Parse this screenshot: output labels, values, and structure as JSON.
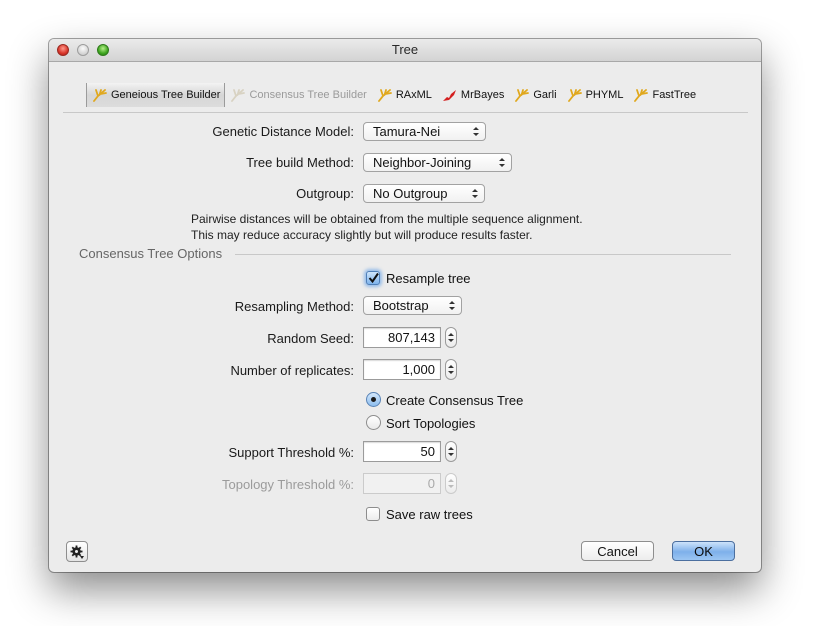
{
  "window": {
    "title": "Tree"
  },
  "tabs": [
    {
      "label": "Geneious Tree Builder",
      "icon": "tree-icon",
      "selected": true,
      "enabled": true,
      "icon_color": "#e0a81e"
    },
    {
      "label": "Consensus Tree Builder",
      "icon": "tree-icon",
      "selected": false,
      "enabled": false,
      "icon_color": "#d8d2c2"
    },
    {
      "label": "RAxML",
      "icon": "tree-icon",
      "selected": false,
      "enabled": true,
      "icon_color": "#e0a81e"
    },
    {
      "label": "MrBayes",
      "icon": "mrbayes-icon",
      "selected": false,
      "enabled": true,
      "icon_color": "#d42020"
    },
    {
      "label": "Garli",
      "icon": "tree-icon",
      "selected": false,
      "enabled": true,
      "icon_color": "#e0a81e"
    },
    {
      "label": "PHYML",
      "icon": "tree-icon",
      "selected": false,
      "enabled": true,
      "icon_color": "#e0a81e"
    },
    {
      "label": "FastTree",
      "icon": "tree-icon",
      "selected": false,
      "enabled": true,
      "icon_color": "#e0a81e"
    }
  ],
  "main": {
    "distance_model": {
      "label": "Genetic Distance Model:",
      "value": "Tamura-Nei"
    },
    "build_method": {
      "label": "Tree build Method:",
      "value": "Neighbor-Joining"
    },
    "outgroup": {
      "label": "Outgroup:",
      "value": "No Outgroup"
    },
    "description": [
      "Pairwise distances will be obtained from the multiple sequence alignment.",
      "This may reduce accuracy slightly but will produce results faster."
    ]
  },
  "consensus": {
    "group_title": "Consensus Tree Options",
    "resample_tree": {
      "label": "Resample tree",
      "checked": true
    },
    "resampling_method": {
      "label": "Resampling Method:",
      "value": "Bootstrap"
    },
    "random_seed": {
      "label": "Random Seed:",
      "value": "807,143"
    },
    "replicates": {
      "label": "Number of replicates:",
      "value": "1,000"
    },
    "mode_options": [
      {
        "label": "Create Consensus Tree",
        "selected": true
      },
      {
        "label": "Sort Topologies",
        "selected": false
      }
    ],
    "support_threshold": {
      "label": "Support Threshold %:",
      "value": "50",
      "enabled": true
    },
    "topology_threshold": {
      "label": "Topology Threshold %:",
      "value": "0",
      "enabled": false
    },
    "save_raw_trees": {
      "label": "Save raw trees",
      "checked": false
    }
  },
  "footer": {
    "options_icon": "gear-icon",
    "cancel_label": "Cancel",
    "ok_label": "OK"
  }
}
